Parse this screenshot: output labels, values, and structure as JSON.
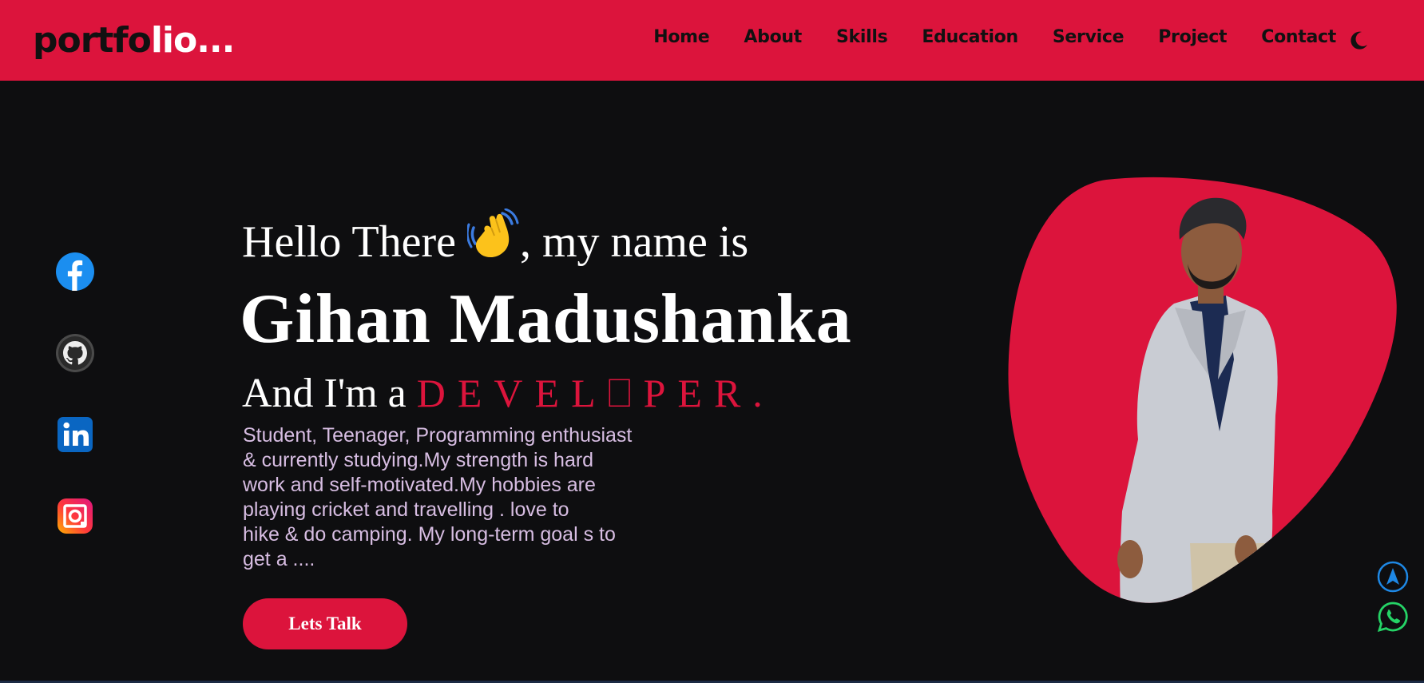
{
  "logo": {
    "part1": "portfo",
    "part2": "lio..."
  },
  "nav": {
    "items": [
      "Home",
      "About",
      "Skills",
      "Education",
      "Service",
      "Project",
      "Contact"
    ],
    "theme_icon": "moon-icon"
  },
  "social": {
    "icons": [
      "facebook-icon",
      "github-icon",
      "linkedin-icon",
      "instagram-icon"
    ]
  },
  "hero": {
    "greeting_before": "Hello There ",
    "greeting_after": ", my name is",
    "wave_icon": "waving-hand-icon",
    "name": "Gihan Madushanka",
    "role_prefix": "And I'm a ",
    "role_typed": "DEVEL⎕PER.",
    "bio": "Student, Teenager, Programming enthusiast\n& currently  studying.My strength is hard\nwork and  self-motivated.My   hobbies are\nplaying cricket  and travelling . love to\nhike & do camping. My long-term goal s to\nget a ....",
    "cta_label": "Lets Talk"
  },
  "floating": {
    "up_icon": "navigation-arrow-icon",
    "chat_icon": "whatsapp-icon"
  },
  "colors": {
    "accent": "#dc143c",
    "background": "#0e0e10",
    "bio_text": "#d7bde2",
    "whatsapp": "#25d366",
    "scroll_up": "#1e88e5"
  }
}
